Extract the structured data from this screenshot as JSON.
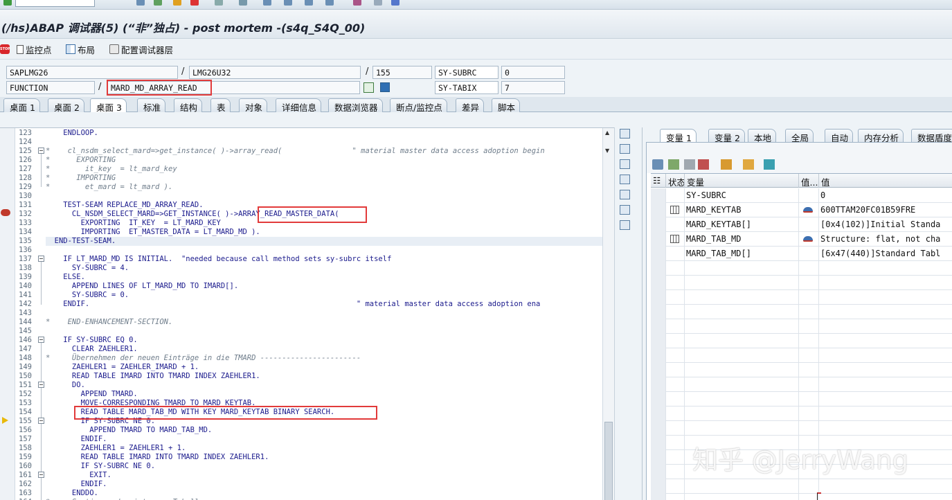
{
  "window": {
    "title": "(/hs)ABAP 调试器(5) (“非”独占) - post mortem -(s4q_S4Q_00)"
  },
  "app_toolbar": {
    "stop_icon": "stop-icon",
    "buttons": [
      {
        "label": "监控点",
        "icon": "document-icon"
      },
      {
        "label": "布局",
        "icon": "layout-icon"
      },
      {
        "label": "配置调试器层",
        "icon": "configure-icon"
      }
    ]
  },
  "fields": {
    "program": "SAPLMG26",
    "include": "LMG26U32",
    "line": "155",
    "event_type": "FUNCTION",
    "event": "MARD_MD_ARRAY_READ",
    "subrc_label": "SY-SUBRC",
    "subrc_value": "0",
    "tabix_label": "SY-TABIX",
    "tabix_value": "7",
    "sep1": "/",
    "sep2": "/",
    "sep3": "/"
  },
  "desk_tabs": [
    "桌面 1",
    "桌面 2",
    "桌面 3",
    "标准",
    "结构",
    "表",
    "对象",
    "详细信息",
    "数据浏览器",
    "断点/监控点",
    "差异",
    "脚本"
  ],
  "code": {
    "lines": [
      {
        "n": "123",
        "t": "    ENDLOOP."
      },
      {
        "n": "124",
        "t": ""
      },
      {
        "n": "125",
        "t": "*    cl_nsdm_select_mard=>get_instance( )->array_read(                \" material master data access adoption begin"
      },
      {
        "n": "126",
        "t": "*      EXPORTING"
      },
      {
        "n": "127",
        "t": "*        it_key  = lt_mard_key"
      },
      {
        "n": "128",
        "t": "*      IMPORTING"
      },
      {
        "n": "129",
        "t": "*        et_mard = lt_mard )."
      },
      {
        "n": "130",
        "t": ""
      },
      {
        "n": "131",
        "t": "    TEST-SEAM REPLACE_MD_ARRAY_READ."
      },
      {
        "n": "132",
        "t": "      CL_NSDM_SELECT_MARD=>GET_INSTANCE( )->ARRAY_READ_MASTER_DATA("
      },
      {
        "n": "133",
        "t": "        EXPORTING  IT_KEY  = LT_MARD_KEY"
      },
      {
        "n": "134",
        "t": "        IMPORTING  ET_MASTER_DATA = LT_MARD_MD )."
      },
      {
        "n": "135",
        "t": "  END-TEST-SEAM."
      },
      {
        "n": "136",
        "t": ""
      },
      {
        "n": "137",
        "t": "    IF LT_MARD_MD IS INITIAL.  \"needed because call method sets sy-subrc itself"
      },
      {
        "n": "138",
        "t": "      SY-SUBRC = 4."
      },
      {
        "n": "139",
        "t": "    ELSE."
      },
      {
        "n": "140",
        "t": "      APPEND LINES OF LT_MARD_MD TO IMARD[]."
      },
      {
        "n": "141",
        "t": "      SY-SUBRC = 0."
      },
      {
        "n": "142",
        "t": "    ENDIF.                                                             \" material master data access adoption ena"
      },
      {
        "n": "143",
        "t": ""
      },
      {
        "n": "144",
        "t": "*    END-ENHANCEMENT-SECTION."
      },
      {
        "n": "145",
        "t": ""
      },
      {
        "n": "146",
        "t": "    IF SY-SUBRC EQ 0."
      },
      {
        "n": "147",
        "t": "      CLEAR ZAEHLER1."
      },
      {
        "n": "148",
        "t": "*     Übernehmen der neuen Einträge in die TMARD -----------------------"
      },
      {
        "n": "149",
        "t": "      ZAEHLER1 = ZAEHLER_IMARD + 1."
      },
      {
        "n": "150",
        "t": "      READ TABLE IMARD INTO TMARD INDEX ZAEHLER1."
      },
      {
        "n": "151",
        "t": "      DO."
      },
      {
        "n": "152",
        "t": "        APPEND TMARD."
      },
      {
        "n": "153",
        "t": "        MOVE-CORRESPONDING TMARD TO MARD_KEYTAB."
      },
      {
        "n": "154",
        "t": "        READ TABLE MARD_TAB_MD WITH KEY MARD_KEYTAB BINARY SEARCH."
      },
      {
        "n": "155",
        "t": "        IF SY-SUBRC NE 0."
      },
      {
        "n": "156",
        "t": "          APPEND TMARD TO MARD_TAB_MD."
      },
      {
        "n": "157",
        "t": "        ENDIF."
      },
      {
        "n": "158",
        "t": "        ZAEHLER1 = ZAEHLER1 + 1."
      },
      {
        "n": "159",
        "t": "        READ TABLE IMARD INTO TMARD INDEX ZAEHLER1."
      },
      {
        "n": "160",
        "t": "        IF SY-SUBRC NE 0."
      },
      {
        "n": "161",
        "t": "          EXIT."
      },
      {
        "n": "162",
        "t": "        ENDIF."
      },
      {
        "n": "163",
        "t": "      ENDDO."
      },
      {
        "n": "164",
        "t": "*     Sortieren der internen Tabelle"
      }
    ]
  },
  "var_tabs": [
    "变量 1",
    "变量 2",
    "本地",
    "全局",
    "自动",
    "内存分析",
    "数据盾度"
  ],
  "var_grid": {
    "headers": {
      "status": "状态",
      "variable": "变量",
      "value_type": "值...",
      "value": "值"
    },
    "rows": [
      {
        "icon": "",
        "variable": "SY-SUBRC",
        "type_icon": "",
        "value": "0"
      },
      {
        "icon": "table-icon",
        "variable": "MARD_KEYTAB",
        "type_icon": "hat-icon",
        "value": "600TTAM20FC01B59FRE"
      },
      {
        "icon": "",
        "variable": "MARD_KEYTAB[]",
        "type_icon": "",
        "value": "[0x4(102)]Initial Standa"
      },
      {
        "icon": "table-icon",
        "variable": "MARD_TAB_MD",
        "type_icon": "hat-icon",
        "value": "Structure: flat, not cha"
      },
      {
        "icon": "",
        "variable": "MARD_TAB_MD[]",
        "type_icon": "",
        "value": "[6x47(440)]Standard Tabl"
      }
    ]
  },
  "watermark": "知乎 @JerryWang",
  "colors": {
    "highlight_box": "#e23a3a",
    "keyword": "#1a1a8c",
    "comment": "#6f7d8b"
  }
}
